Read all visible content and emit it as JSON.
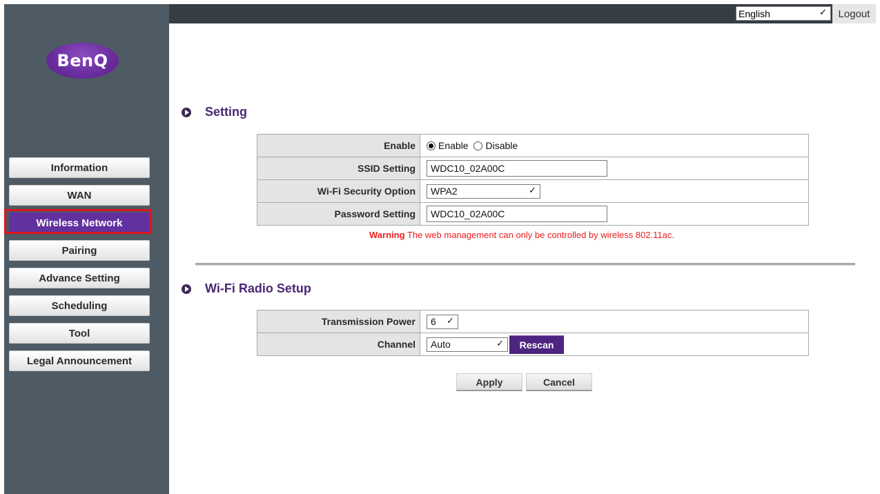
{
  "brand": {
    "logo_text": "BenQ"
  },
  "topbar": {
    "language": "English",
    "logout_label": "Logout"
  },
  "sidebar": {
    "items": [
      {
        "label": "Information"
      },
      {
        "label": "WAN"
      },
      {
        "label": "Wireless Network",
        "active": true
      },
      {
        "label": "Pairing"
      },
      {
        "label": "Advance Setting"
      },
      {
        "label": "Scheduling"
      },
      {
        "label": "Tool"
      },
      {
        "label": "Legal Announcement"
      }
    ]
  },
  "setting": {
    "title": "Setting",
    "enable_label": "Enable",
    "enable_option": "Enable",
    "disable_option": "Disable",
    "enable_selected": "Enable",
    "ssid_label": "SSID Setting",
    "ssid_value": "WDC10_02A00C",
    "security_label": "Wi-Fi Security Option",
    "security_value": "WPA2",
    "password_label": "Password Setting",
    "password_value": "WDC10_02A00C",
    "warning_prefix": "Warning",
    "warning_text": "The web management can only be controlled by wireless 802.11ac."
  },
  "radio_setup": {
    "title": "Wi-Fi Radio Setup",
    "power_label": "Transmission Power",
    "power_value": "6",
    "channel_label": "Channel",
    "channel_value": "Auto",
    "rescan_label": "Rescan"
  },
  "actions": {
    "apply_label": "Apply",
    "cancel_label": "Cancel"
  },
  "colors": {
    "accent": "#6231a0",
    "sidebar_bg": "#4e5a64",
    "topbar_bg": "#363d43",
    "warning": "#ee1c1c",
    "highlight": "#e0141a"
  }
}
